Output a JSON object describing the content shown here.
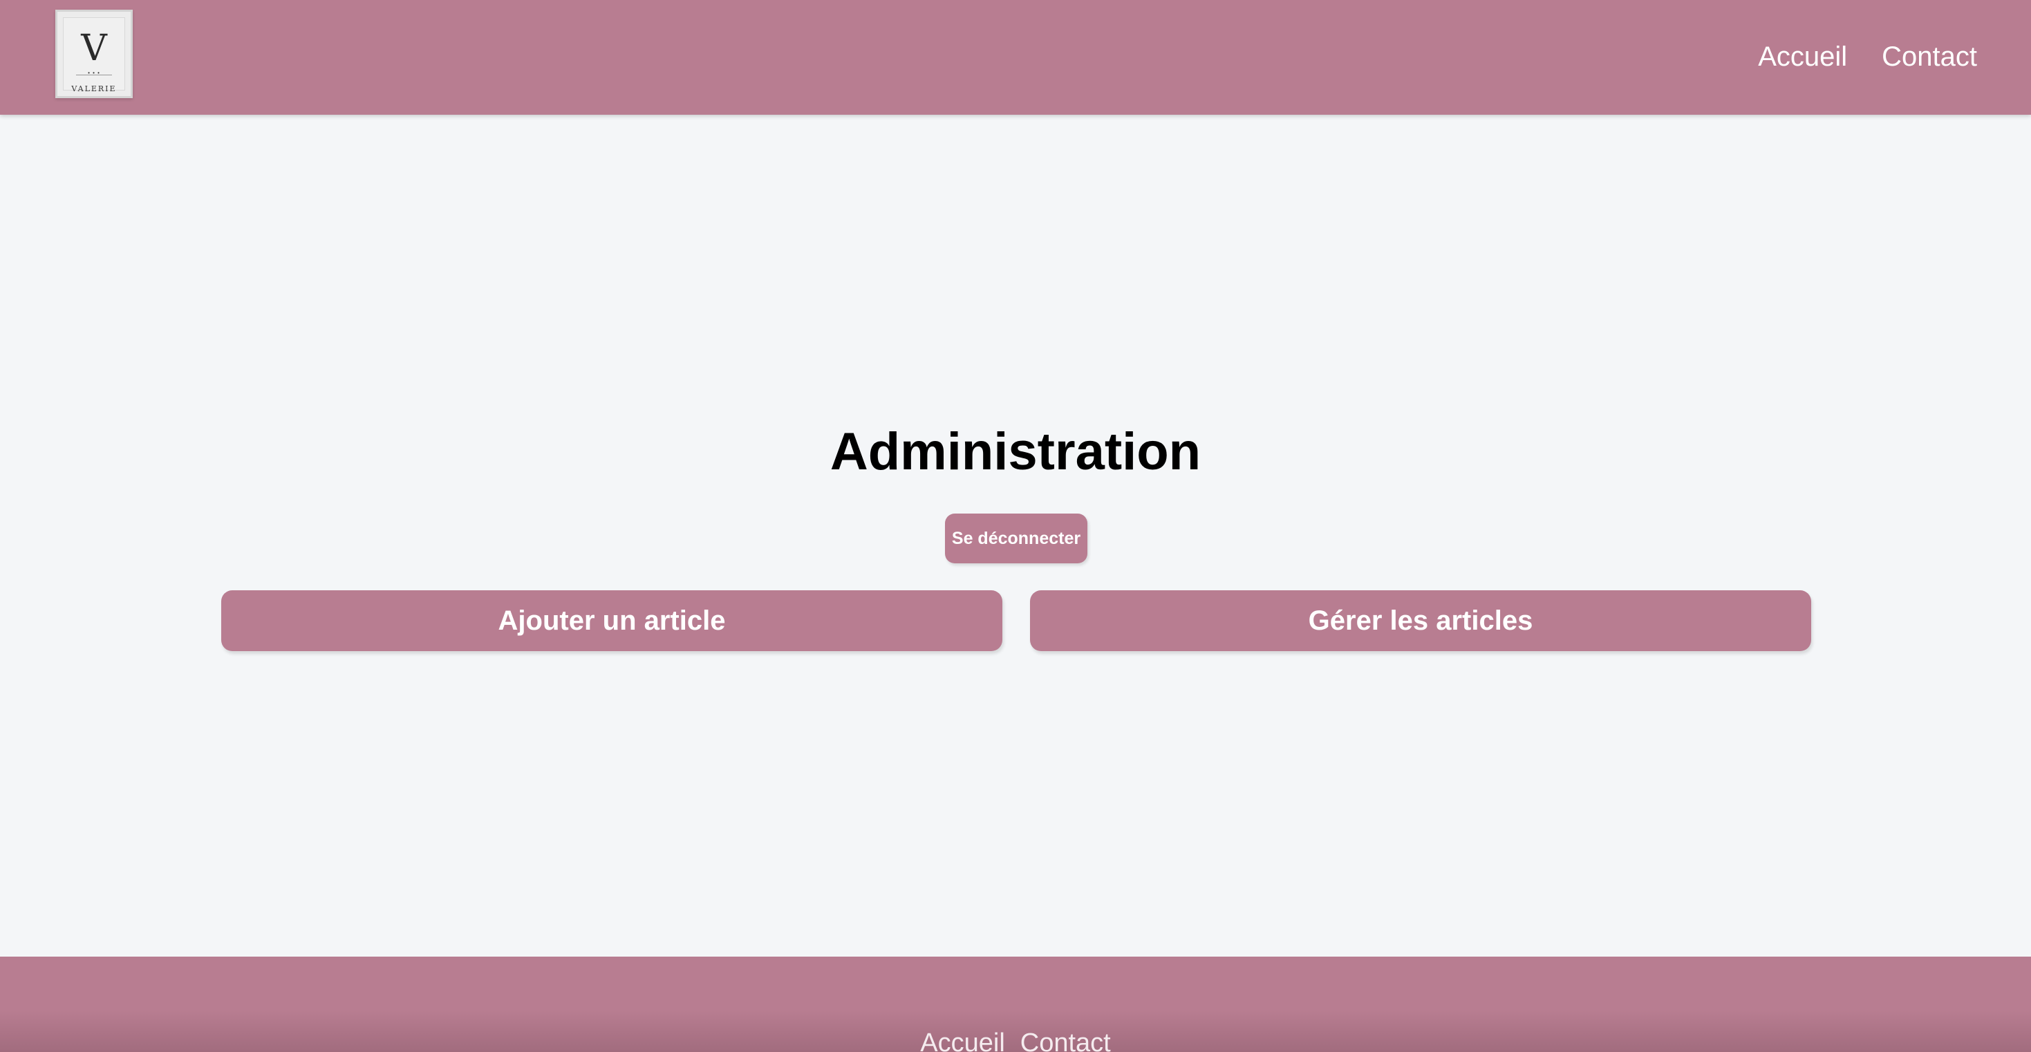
{
  "header": {
    "logo": {
      "letter": "V",
      "text": "VALERIE",
      "icon": "valerie-logo-icon"
    },
    "nav": [
      {
        "label": "Accueil"
      },
      {
        "label": "Contact"
      }
    ]
  },
  "main": {
    "title": "Administration",
    "logout_label": "Se déconnecter",
    "actions": [
      {
        "label": "Ajouter un article"
      },
      {
        "label": "Gérer les articles"
      }
    ]
  },
  "footer": {
    "nav": [
      {
        "label": "Accueil"
      },
      {
        "label": "Contact"
      }
    ]
  },
  "colors": {
    "brand": "#b87d91",
    "background": "#f4f6f8",
    "text": "#000000",
    "button_text": "#ffffff"
  }
}
